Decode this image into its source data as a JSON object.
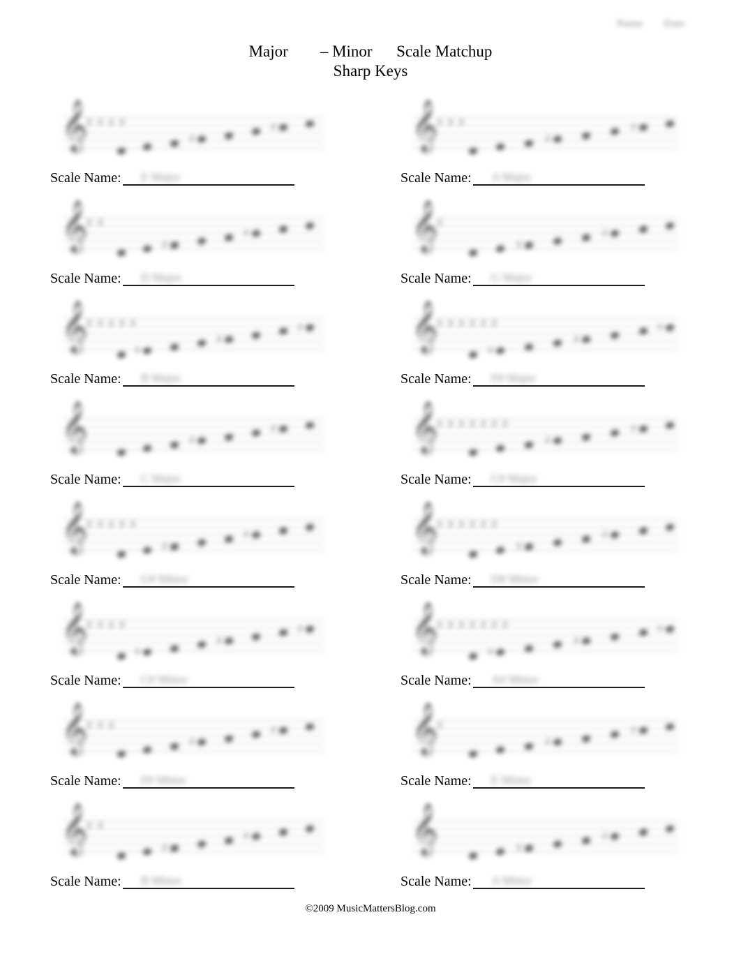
{
  "header": {
    "blurred_fields": [
      "Name",
      "Date"
    ]
  },
  "title": {
    "line1": "Major        – Minor      Scale Matchup",
    "line2": "Sharp Keys"
  },
  "footer": {
    "copyright": "©2009 MusicMattersBlog.com"
  },
  "labels": {
    "scale_name": "Scale Name:"
  },
  "worksheet": {
    "rows": [
      {
        "left": {
          "staff": "treble-staff-1",
          "sharps": 4,
          "answer": "E Major"
        },
        "right": {
          "staff": "treble-staff-2",
          "sharps": 3,
          "answer": "A Major"
        }
      },
      {
        "left": {
          "staff": "treble-staff-3",
          "sharps": 2,
          "answer": "D Major"
        },
        "right": {
          "staff": "treble-staff-4",
          "sharps": 1,
          "answer": "G Major"
        }
      },
      {
        "left": {
          "staff": "treble-staff-5",
          "sharps": 5,
          "answer": "B Major"
        },
        "right": {
          "staff": "treble-staff-6",
          "sharps": 6,
          "answer": "F# Major"
        }
      },
      {
        "left": {
          "staff": "treble-staff-7",
          "sharps": 0,
          "answer": "C Major"
        },
        "right": {
          "staff": "treble-staff-8",
          "sharps": 7,
          "answer": "C# Major"
        }
      },
      {
        "left": {
          "staff": "treble-staff-9",
          "sharps": 5,
          "answer": "G# Minor"
        },
        "right": {
          "staff": "treble-staff-10",
          "sharps": 6,
          "answer": "D# Minor"
        }
      },
      {
        "left": {
          "staff": "treble-staff-11",
          "sharps": 4,
          "answer": "C# Minor"
        },
        "right": {
          "staff": "treble-staff-12",
          "sharps": 7,
          "answer": "A# Minor"
        }
      },
      {
        "left": {
          "staff": "treble-staff-13",
          "sharps": 3,
          "answer": "F# Minor"
        },
        "right": {
          "staff": "treble-staff-14",
          "sharps": 1,
          "answer": "E Minor"
        }
      },
      {
        "left": {
          "staff": "treble-staff-15",
          "sharps": 2,
          "answer": "B Minor"
        },
        "right": {
          "staff": "treble-staff-16",
          "sharps": 0,
          "answer": "A Minor"
        }
      }
    ]
  },
  "icons": {
    "treble_clef": "𝄞",
    "sharp": "♯"
  }
}
